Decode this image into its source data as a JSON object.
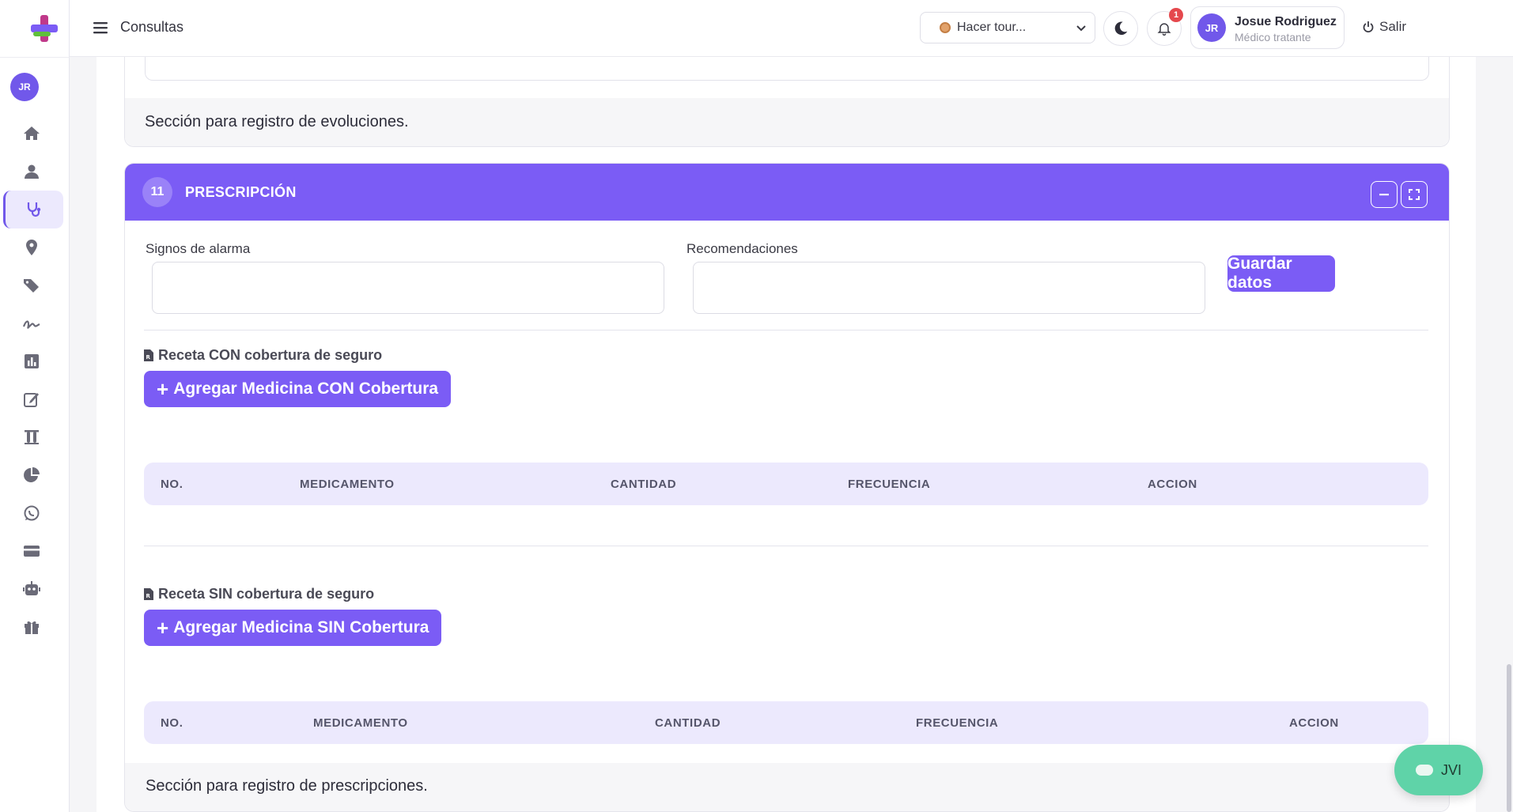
{
  "topbar": {
    "page_title": "Consultas",
    "tour_select_value": "Hacer tour...",
    "notification_count": "1",
    "user_initials": "JR",
    "user_name": "Josue Rodriguez",
    "user_role": "Médico tratante",
    "logout_label": "Salir"
  },
  "sidebar": {
    "avatar_initials": "JR",
    "items": [
      {
        "icon": "home-icon"
      },
      {
        "icon": "user-icon"
      },
      {
        "icon": "stethoscope-icon",
        "active": true
      },
      {
        "icon": "map-pin-icon"
      },
      {
        "icon": "tags-icon"
      },
      {
        "icon": "signature-icon"
      },
      {
        "icon": "bar-chart-icon"
      },
      {
        "icon": "edit-icon"
      },
      {
        "icon": "test-tubes-icon"
      },
      {
        "icon": "pie-chart-icon"
      },
      {
        "icon": "whatsapp-icon"
      },
      {
        "icon": "credit-card-icon"
      },
      {
        "icon": "robot-icon"
      },
      {
        "icon": "gift-icon"
      }
    ]
  },
  "previous_section": {
    "footer_text": "Sección para registro de evoluciones."
  },
  "prescription": {
    "number": "11",
    "title": "PRESCRIPCIÓN",
    "alarm_signs_label": "Signos de alarma",
    "alarm_signs_value": "",
    "recommendations_label": "Recomendaciones",
    "recommendations_value": "",
    "save_button": "Guardar datos",
    "with_insurance": {
      "label": "Receta CON cobertura de seguro",
      "add_button": "Agregar Medicina CON Cobertura",
      "columns": [
        "NO.",
        "MEDICAMENTO",
        "CANTIDAD",
        "FRECUENCIA",
        "ACCION"
      ]
    },
    "without_insurance": {
      "label": "Receta SIN cobertura de seguro",
      "add_button": "Agregar Medicina SIN Cobertura",
      "columns": [
        "NO.",
        "MEDICAMENTO",
        "CANTIDAD",
        "FRECUENCIA",
        "ACCION"
      ]
    },
    "footer_text": "Sección para registro de prescripciones."
  },
  "chat": {
    "label": "JVI"
  },
  "colors": {
    "accent": "#7b5cf5",
    "table_header_bg": "#ece9fd",
    "chat_button": "#5fd3a8",
    "badge": "#e5484d"
  }
}
